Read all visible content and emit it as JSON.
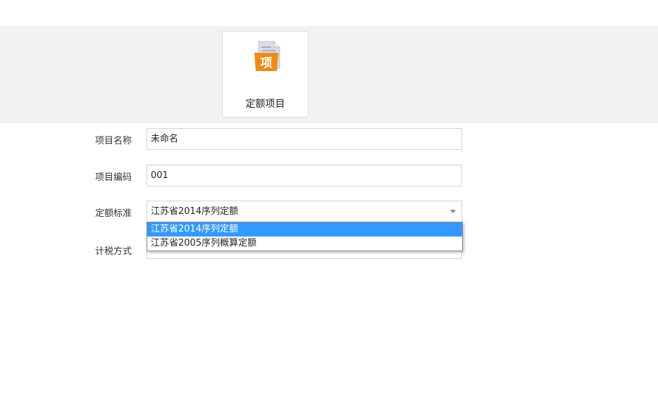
{
  "toolbar": {
    "tile": {
      "label": "定额项目",
      "icon": "document-xiang-icon",
      "icon_glyph": "项"
    }
  },
  "form": {
    "project_name": {
      "label": "项目名称",
      "value": "未命名"
    },
    "project_code": {
      "label": "项目编码",
      "value": "001"
    },
    "quota_standard": {
      "label": "定额标准",
      "value": "江苏省2014序列定额",
      "options": [
        "江苏省2014序列定额",
        "江苏省2005序列概算定额"
      ]
    },
    "tax_method": {
      "label": "计税方式"
    }
  },
  "colors": {
    "selected": "#3399ff",
    "icon_orange": "#f08a1c",
    "band": "#f2f2f2"
  }
}
